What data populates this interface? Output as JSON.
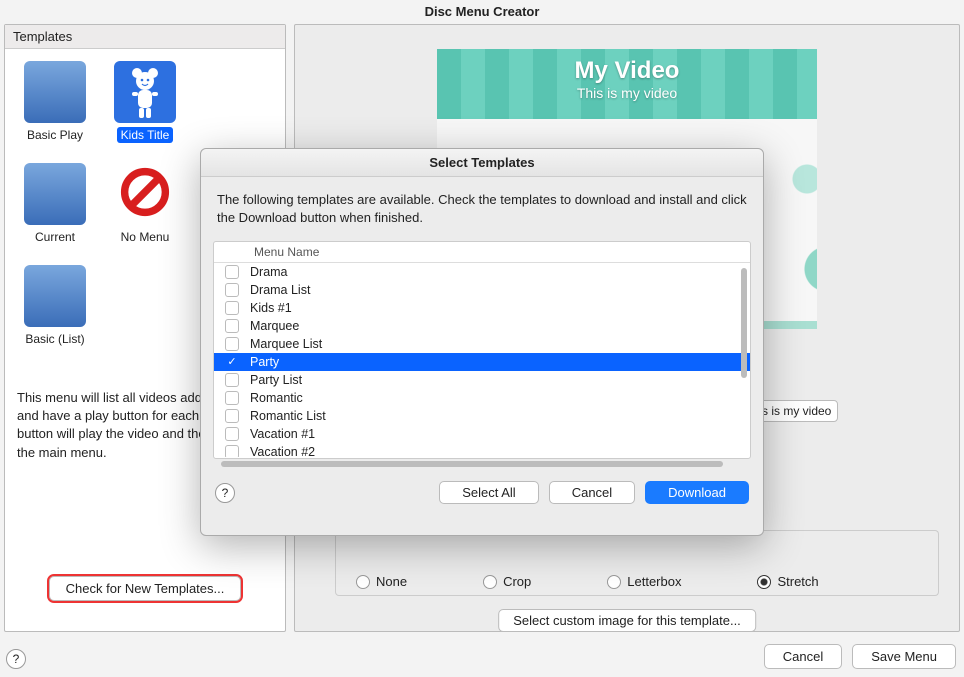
{
  "window_title": "Disc Menu Creator",
  "left": {
    "header": "Templates",
    "templates": [
      {
        "label": "Basic Play"
      },
      {
        "label": "Kids Title"
      },
      {
        "label": ""
      },
      {
        "label": "Current"
      },
      {
        "label": "No Menu"
      },
      {
        "label": ""
      },
      {
        "label": "Basic (List)"
      }
    ],
    "description": "This menu will list all videos added to a disc and have a play button for each title. This button will play the video and then return to the main menu.",
    "check_button": "Check for New Templates..."
  },
  "preview": {
    "title": "My Video",
    "subtitle": "This is my video",
    "subtitle_field_prefix": "s is my video"
  },
  "scale": {
    "options": [
      "None",
      "Crop",
      "Letterbox",
      "Stretch"
    ],
    "selected": "Stretch"
  },
  "custom_image_button": "Select custom image for this template...",
  "bottom": {
    "cancel": "Cancel",
    "save": "Save Menu",
    "help": "?"
  },
  "modal": {
    "title": "Select Templates",
    "description": "The following templates are available.  Check the templates to download and install and click the Download button when finished.",
    "column_header": "Menu Name",
    "rows": [
      {
        "name": "Drama",
        "selected": false
      },
      {
        "name": "Drama List",
        "selected": false
      },
      {
        "name": "Kids #1",
        "selected": false
      },
      {
        "name": "Marquee",
        "selected": false
      },
      {
        "name": "Marquee List",
        "selected": false
      },
      {
        "name": "Party",
        "selected": true
      },
      {
        "name": "Party List",
        "selected": false
      },
      {
        "name": "Romantic",
        "selected": false
      },
      {
        "name": "Romantic List",
        "selected": false
      },
      {
        "name": "Vacation #1",
        "selected": false
      },
      {
        "name": "Vacation #2",
        "selected": false
      }
    ],
    "buttons": {
      "help": "?",
      "select_all": "Select All",
      "cancel": "Cancel",
      "download": "Download"
    }
  }
}
